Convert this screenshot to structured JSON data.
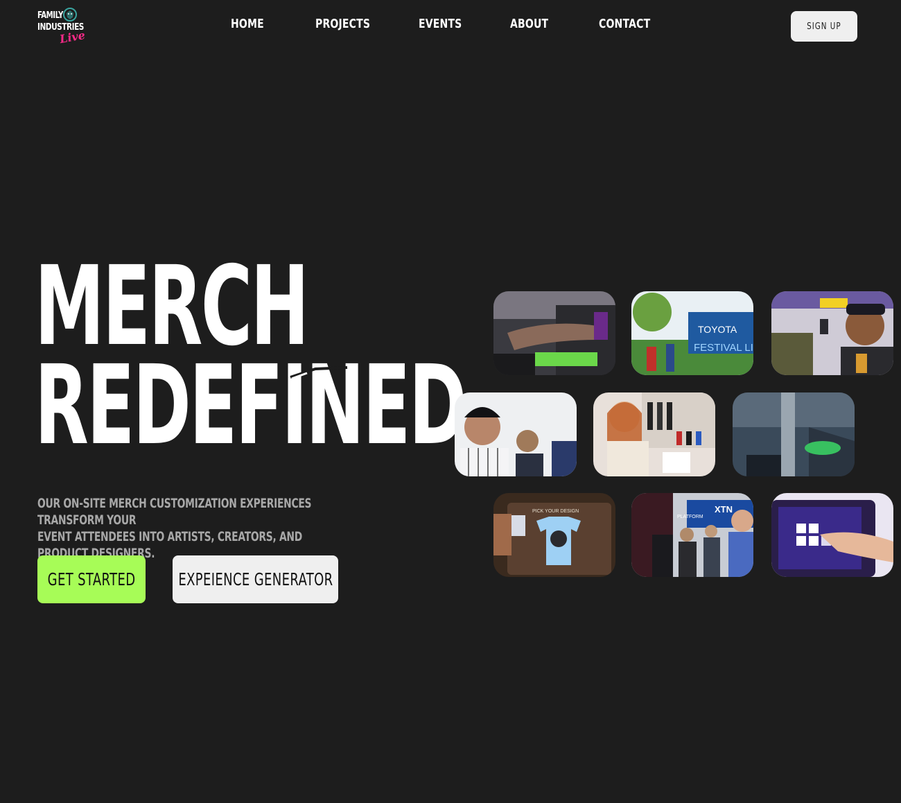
{
  "brand": {
    "logo_line1": "FAMILY",
    "logo_line2": "INDUSTRIES",
    "logo_script": "Live",
    "accent_pink": "#ff2a8a"
  },
  "nav": {
    "items": [
      {
        "label": "HOME"
      },
      {
        "label": "PROJECTS"
      },
      {
        "label": "EVENTS"
      },
      {
        "label": "ABOUT"
      },
      {
        "label": "CONTACT"
      }
    ],
    "signup_label": "SIGN UP"
  },
  "hero": {
    "headline_line1": "MERCH",
    "headline_line2": "REDEFINED",
    "subtitle_line1": "OUR ON-SITE MERCH CUSTOMIZATION EXPERIENCES TRANSFORM YOUR",
    "subtitle_line2": "EVENT ATTENDEES INTO ARTISTS, CREATORS, AND PRODUCT DESIGNERS.",
    "cta_primary": "GET STARTED",
    "cta_secondary": "EXPEIENCE GENERATOR"
  },
  "tiles": {
    "t2_sign_line1": "TOYOTA",
    "t2_sign_line2": "FESTIVAL LINE",
    "t7_screen_title": "PICK YOUR DESIGN",
    "t8_sign": "XTN",
    "t8_banner": "PLATFORM"
  },
  "colors": {
    "background": "#1d1d1d",
    "cta_green": "#a7fc57",
    "light_button": "#efefef",
    "subtitle_gray": "#a8a8a8"
  }
}
